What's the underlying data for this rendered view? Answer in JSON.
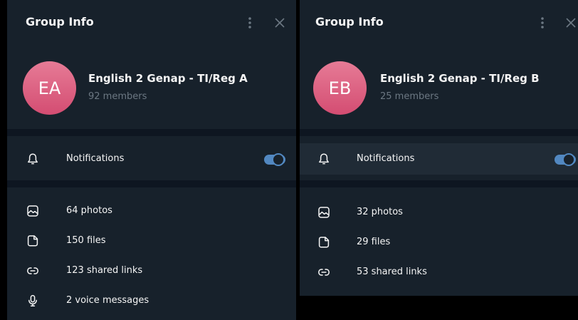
{
  "panel_a": {
    "title": "Group Info",
    "avatar_initials": "EA",
    "group_name": "English 2 Genap - TI/Reg A",
    "member_count": "92 members",
    "notifications_label": "Notifications",
    "notifications_enabled": true,
    "media": [
      {
        "icon": "image-icon",
        "label": "64 photos"
      },
      {
        "icon": "file-icon",
        "label": "150 files"
      },
      {
        "icon": "link-icon",
        "label": "123 shared links"
      },
      {
        "icon": "microphone-icon",
        "label": "2 voice messages"
      }
    ]
  },
  "panel_b": {
    "title": "Group Info",
    "avatar_initials": "EB",
    "group_name": "English 2 Genap - TI/Reg B",
    "member_count": "25 members",
    "notifications_label": "Notifications",
    "notifications_enabled": true,
    "media": [
      {
        "icon": "image-icon",
        "label": "32 photos"
      },
      {
        "icon": "file-icon",
        "label": "29 files"
      },
      {
        "icon": "link-icon",
        "label": "53 shared links"
      }
    ]
  },
  "colors": {
    "panel_bg": "#17212b",
    "divider": "#0e1621",
    "accent": "#5288c1",
    "avatar_top": "#e67b96",
    "avatar_bottom": "#d44d72",
    "muted_text": "#6c7883"
  }
}
